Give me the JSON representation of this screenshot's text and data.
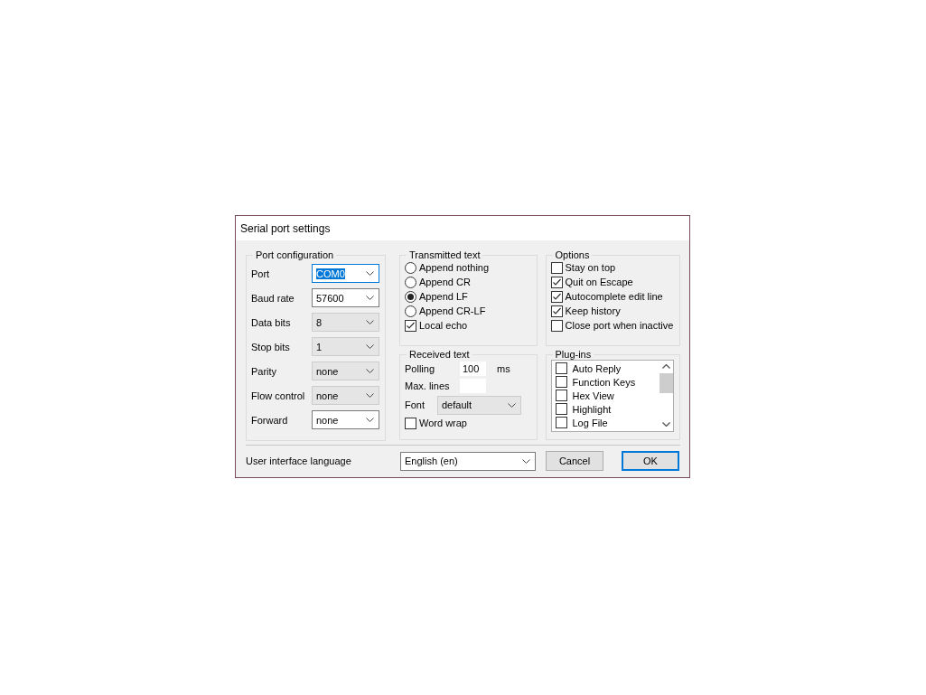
{
  "window": {
    "title": "Serial port settings"
  },
  "port_configuration": {
    "title": "Port configuration",
    "fields": [
      {
        "label": "Port",
        "value": "COM0",
        "disabled": false,
        "focused": true
      },
      {
        "label": "Baud rate",
        "value": "57600",
        "disabled": false,
        "focused": false
      },
      {
        "label": "Data bits",
        "value": "8",
        "disabled": true,
        "focused": false
      },
      {
        "label": "Stop bits",
        "value": "1",
        "disabled": true,
        "focused": false
      },
      {
        "label": "Parity",
        "value": "none",
        "disabled": true,
        "focused": false
      },
      {
        "label": "Flow control",
        "value": "none",
        "disabled": true,
        "focused": false
      },
      {
        "label": "Forward",
        "value": "none",
        "disabled": false,
        "focused": false
      }
    ]
  },
  "transmitted_text": {
    "title": "Transmitted text",
    "options": [
      {
        "label": "Append nothing",
        "selected": false
      },
      {
        "label": "Append CR",
        "selected": false
      },
      {
        "label": "Append LF",
        "selected": true
      },
      {
        "label": "Append CR-LF",
        "selected": false
      }
    ],
    "local_echo": {
      "label": "Local echo",
      "checked": true
    }
  },
  "received_text": {
    "title": "Received text",
    "polling": {
      "label": "Polling",
      "value": "100",
      "unit": "ms"
    },
    "max_lines": {
      "label": "Max. lines"
    },
    "font": {
      "label": "Font",
      "value": "default",
      "disabled": true
    },
    "word_wrap": {
      "label": "Word wrap",
      "checked": false
    }
  },
  "options": {
    "title": "Options",
    "items": [
      {
        "label": "Stay on top",
        "checked": false
      },
      {
        "label": "Quit on Escape",
        "checked": true
      },
      {
        "label": "Autocomplete edit line",
        "checked": true
      },
      {
        "label": "Keep history",
        "checked": true
      },
      {
        "label": "Close port when inactive",
        "checked": false
      }
    ]
  },
  "plugins": {
    "title": "Plug-ins",
    "items": [
      {
        "label": "Auto Reply",
        "checked": false
      },
      {
        "label": "Function Keys",
        "checked": false
      },
      {
        "label": "Hex View",
        "checked": false
      },
      {
        "label": "Highlight",
        "checked": false
      },
      {
        "label": "Log File",
        "checked": false
      }
    ]
  },
  "language": {
    "label": "User interface language",
    "value": "English (en)"
  },
  "buttons": [
    {
      "label": "Cancel",
      "default": false
    },
    {
      "label": "OK",
      "default": true
    }
  ]
}
